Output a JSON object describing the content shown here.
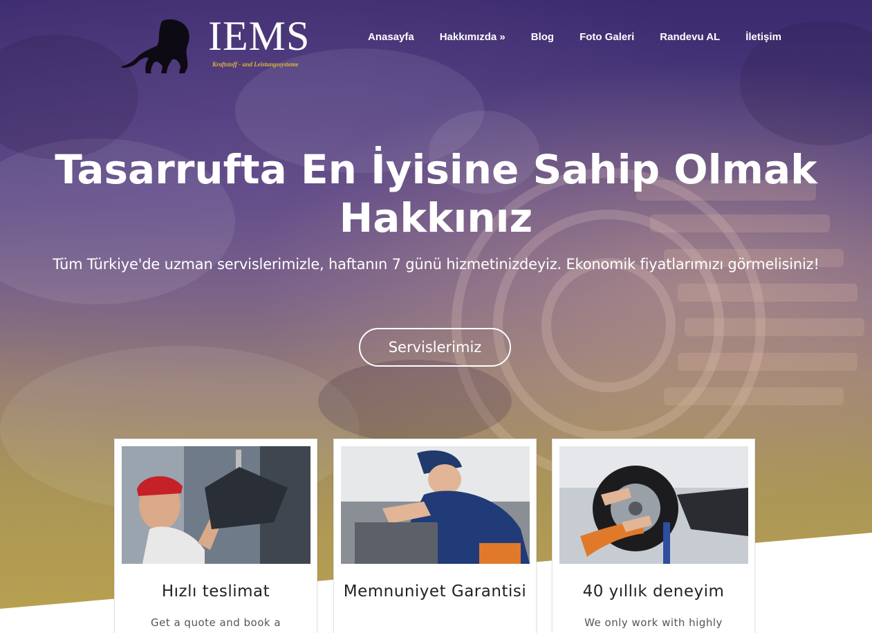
{
  "brand": {
    "name": "IEMS",
    "tagline": "Kraftstoff - und Leistungssysteme"
  },
  "nav": {
    "items": [
      "Anasayfa",
      "Hakkımızda »",
      "Blog",
      "Foto Galeri",
      "Randevu AL",
      "İletişim"
    ]
  },
  "hero": {
    "title_line1": "Tasarrufta En İyisine Sahip Olmak",
    "title_line2": "Hakkınız",
    "subtitle": "Tüm Türkiye'de uzman servislerimizle, haftanın 7 günü hizmetinizdeyiz. Ekonomik fiyatlarımızı görmelisiniz!",
    "cta_label": "Servislerimiz"
  },
  "cards": [
    {
      "title": "Hızlı teslimat",
      "desc": "Get a quote and book a"
    },
    {
      "title": "Memnuniyet Garantisi",
      "desc": ""
    },
    {
      "title": "40 yıllık deneyim",
      "desc": "We only work with highly"
    }
  ],
  "colors": {
    "hero_top": "#3a2a6e",
    "hero_bottom": "#b9a24e",
    "logo_tag": "#e3b53a"
  }
}
